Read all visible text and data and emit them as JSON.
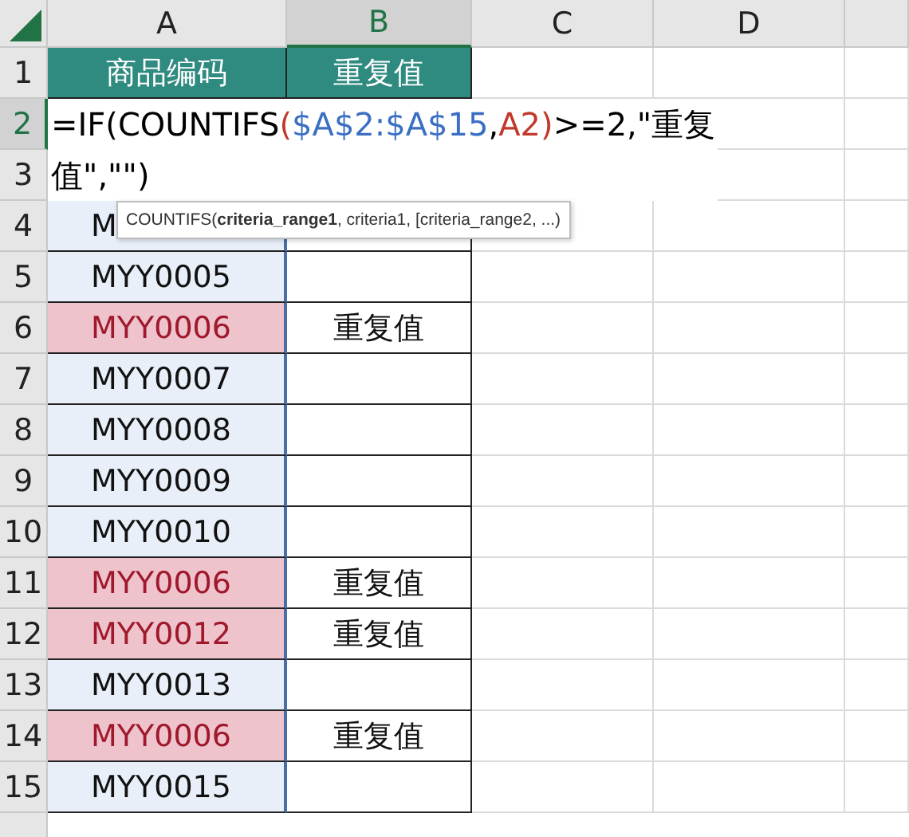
{
  "columns": [
    {
      "label": "A",
      "selected": false
    },
    {
      "label": "B",
      "selected": true
    },
    {
      "label": "C",
      "selected": false
    },
    {
      "label": "D",
      "selected": false
    }
  ],
  "rows": [
    {
      "number": "1",
      "selected": false,
      "cells": [
        {
          "kind": "header",
          "text": "商品编码"
        },
        {
          "kind": "header",
          "text": "重复值"
        }
      ]
    },
    {
      "number": "2",
      "selected": true,
      "cells": []
    },
    {
      "number": "3",
      "selected": false,
      "cells": []
    },
    {
      "number": "4",
      "selected": false,
      "cells": [
        {
          "kind": "data",
          "text": "M",
          "duplicate": false
        },
        {
          "kind": "data",
          "duplicate": false
        }
      ]
    },
    {
      "number": "5",
      "selected": false,
      "cells": [
        {
          "kind": "data",
          "text": "MYY0005",
          "duplicate": false
        },
        {
          "kind": "data",
          "duplicate": false
        }
      ]
    },
    {
      "number": "6",
      "selected": false,
      "cells": [
        {
          "kind": "data",
          "text": "MYY0006",
          "duplicate": true
        },
        {
          "kind": "data",
          "text": "重复值",
          "duplicate": false
        }
      ]
    },
    {
      "number": "7",
      "selected": false,
      "cells": [
        {
          "kind": "data",
          "text": "MYY0007",
          "duplicate": false
        },
        {
          "kind": "data",
          "duplicate": false
        }
      ]
    },
    {
      "number": "8",
      "selected": false,
      "cells": [
        {
          "kind": "data",
          "text": "MYY0008",
          "duplicate": false
        },
        {
          "kind": "data",
          "duplicate": false
        }
      ]
    },
    {
      "number": "9",
      "selected": false,
      "cells": [
        {
          "kind": "data",
          "text": "MYY0009",
          "duplicate": false
        },
        {
          "kind": "data",
          "duplicate": false
        }
      ]
    },
    {
      "number": "10",
      "selected": false,
      "cells": [
        {
          "kind": "data",
          "text": "MYY0010",
          "duplicate": false
        },
        {
          "kind": "data",
          "duplicate": false
        }
      ]
    },
    {
      "number": "11",
      "selected": false,
      "cells": [
        {
          "kind": "data",
          "text": "MYY0006",
          "duplicate": true
        },
        {
          "kind": "data",
          "text": "重复值",
          "duplicate": false
        }
      ]
    },
    {
      "number": "12",
      "selected": false,
      "cells": [
        {
          "kind": "data",
          "text": "MYY0012",
          "duplicate": true
        },
        {
          "kind": "data",
          "text": "重复值",
          "duplicate": false
        }
      ]
    },
    {
      "number": "13",
      "selected": false,
      "cells": [
        {
          "kind": "data",
          "text": "MYY0013",
          "duplicate": false
        },
        {
          "kind": "data",
          "duplicate": false
        }
      ]
    },
    {
      "number": "14",
      "selected": false,
      "cells": [
        {
          "kind": "data",
          "text": "MYY0006",
          "duplicate": true
        },
        {
          "kind": "data",
          "text": "重复值",
          "duplicate": false
        }
      ]
    },
    {
      "number": "15",
      "selected": false,
      "cells": [
        {
          "kind": "data",
          "text": "MYY0015",
          "duplicate": false
        },
        {
          "kind": "data",
          "duplicate": false
        }
      ]
    }
  ],
  "formula": {
    "parts": [
      {
        "text": "=IF(COUNTIFS",
        "color": "#000000"
      },
      {
        "text": "(",
        "color": "#c0392b"
      },
      {
        "text": "$A$2:$A$15",
        "color": "#3a6fc4"
      },
      {
        "text": ",",
        "color": "#000000"
      },
      {
        "text": "A2)",
        "color": "#c0392b"
      },
      {
        "text": ">=2,\"重复值\",\"\")",
        "color": "#000000"
      }
    ]
  },
  "tooltip": {
    "text": "COUNTIFS(**criteria_range1**, criteria1, [criteria_range2, ...)"
  }
}
